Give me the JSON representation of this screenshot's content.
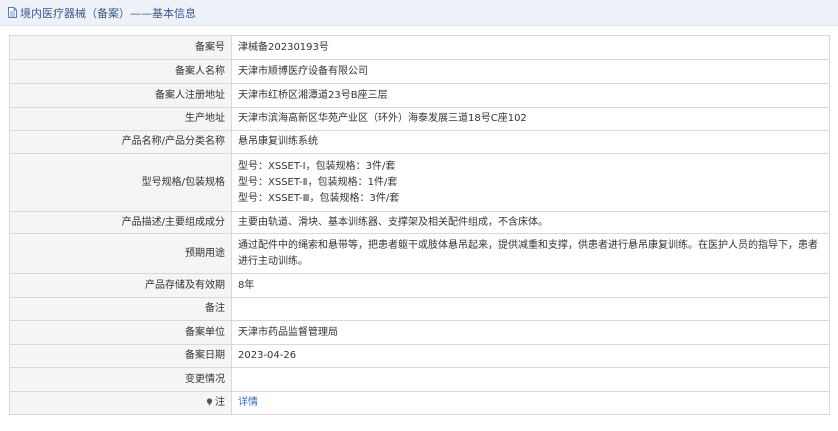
{
  "header": {
    "title": "境内医疗器械（备案）——基本信息",
    "icon": "document-icon"
  },
  "rows": [
    {
      "label": "备案号",
      "value": "津械备20230193号"
    },
    {
      "label": "备案人名称",
      "value": "天津市顺博医疗设备有限公司"
    },
    {
      "label": "备案人注册地址",
      "value": "天津市红桥区湘潭道23号B座三层"
    },
    {
      "label": "生产地址",
      "value": "天津市滨海高新区华苑产业区（环外）海泰发展三道18号C座102"
    },
    {
      "label": "产品名称/产品分类名称",
      "value": "悬吊康复训练系统"
    },
    {
      "label": "型号规格/包装规格",
      "values": [
        "型号：XSSET-Ⅰ，包装规格：3件/套",
        "型号：XSSET-Ⅱ，包装规格：1件/套",
        "型号：XSSET-Ⅲ，包装规格：3件/套"
      ]
    },
    {
      "label": "产品描述/主要组成成分",
      "value": "主要由轨道、滑块、基本训练器、支撑架及相关配件组成，不含床体。"
    },
    {
      "label": "预期用途",
      "value": "通过配件中的绳索和悬带等，把患者躯干或肢体悬吊起来，提供减重和支撑，供患者进行悬吊康复训练。在医护人员的指导下，患者进行主动训练。"
    },
    {
      "label": "产品存储及有效期",
      "value": "8年"
    },
    {
      "label": "备注",
      "value": ""
    },
    {
      "label": "备案单位",
      "value": "天津市药品监督管理局"
    },
    {
      "label": "备案日期",
      "value": "2023-04-26"
    },
    {
      "label": "变更情况",
      "value": ""
    },
    {
      "label": "注",
      "value": "详情",
      "icon": "info-pin-icon"
    }
  ]
}
